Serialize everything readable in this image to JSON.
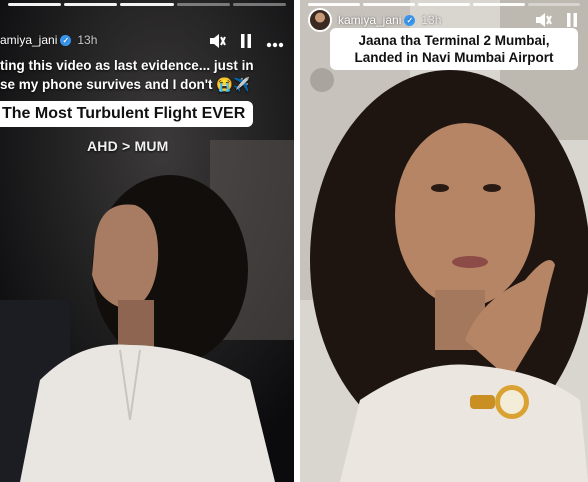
{
  "left_story": {
    "username": "kamiya_jani",
    "time": "13h",
    "caption_line_1": "ting this video as last evidence... just in",
    "caption_line_2": "se my phone survives and I don't 😭✈️",
    "title": "The Most Turbulent Flight EVER",
    "route": "AHD > MUM",
    "icons": {
      "mute": "mute-icon",
      "pause": "pause-icon",
      "more": "more-icon",
      "verified": "verified-badge-icon"
    }
  },
  "right_story": {
    "username": "kamiya_jani",
    "time": "13h",
    "caption_line_1": "Jaana tha Terminal 2 Mumbai,",
    "caption_line_2": "Landed in Navi Mumbai  Airport",
    "icons": {
      "mute": "mute-icon",
      "pause": "pause-icon",
      "verified": "verified-badge-icon"
    }
  },
  "colors": {
    "caption_bg": "#ffffff",
    "verified": "#3897f0"
  }
}
